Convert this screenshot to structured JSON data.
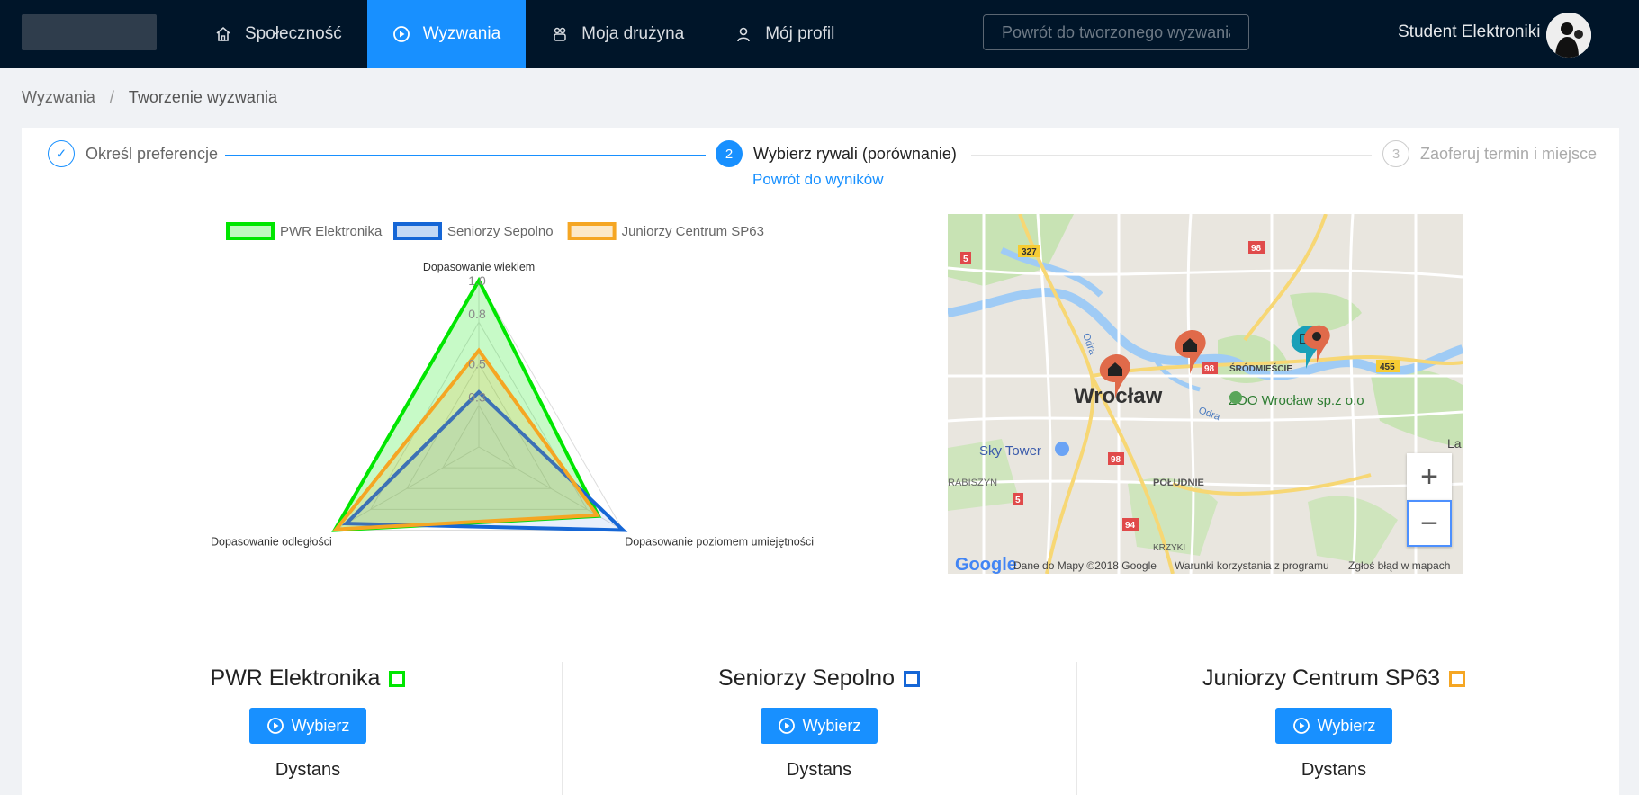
{
  "header": {
    "nav": [
      {
        "label": "Społeczność",
        "icon": "home-icon"
      },
      {
        "label": "Wyzwania",
        "icon": "play-circle-icon"
      },
      {
        "label": "Moja drużyna",
        "icon": "team-icon"
      },
      {
        "label": "Mój profil",
        "icon": "user-icon"
      }
    ],
    "search_placeholder": "Powrót do tworzonego wyzwania",
    "username": "Student Elektroniki"
  },
  "breadcrumb": [
    "Wyzwania",
    "/",
    "Tworzenie wyzwania"
  ],
  "steps": [
    {
      "num": "✓",
      "label": "Określ preferencje",
      "state": "done"
    },
    {
      "num": "2",
      "label": "Wybierz rywali (porównanie)",
      "state": "active"
    },
    {
      "num": "3",
      "label": "Zaoferuj termin i miejsce",
      "state": "pending"
    }
  ],
  "back_link": "Powrót do wyników",
  "chart_data": {
    "type": "radar",
    "axes": [
      "Dopasowanie wiekiem",
      "Dopasowanie poziomem umiejętności",
      "Dopasowanie odległości"
    ],
    "tick_labels": [
      "0.3",
      "0.5",
      "0.8",
      "1.0"
    ],
    "range": [
      0,
      1
    ],
    "legend_position": "top",
    "series": [
      {
        "name": "PWR Elektronika",
        "color": "#00e600",
        "values": [
          1.0,
          0.83,
          1.0
        ]
      },
      {
        "name": "Seniorzy Sepolno",
        "color": "#1566d6",
        "values": [
          0.33,
          1.0,
          0.92
        ]
      },
      {
        "name": "Juniorzy Centrum SP63",
        "color": "#f5a623",
        "values": [
          0.58,
          0.82,
          0.99
        ]
      }
    ]
  },
  "map": {
    "labels": {
      "city": "Wrocław",
      "zoo": "ZOO Wrocław sp.z o.o",
      "sky_tower": "Sky Tower",
      "srodmiescie": "ŚRÓDMIEŚCIE",
      "poludnie": "POŁUDNIE",
      "krzyki": "KRZYKI",
      "grabiszyn": "RABISZYN",
      "river": "Odra",
      "la": "La",
      "road_327": "327",
      "road_98": "98",
      "road_5": "5",
      "road_455": "455",
      "road_94": "94"
    },
    "attribution": [
      "Dane do Mapy ©2018 Google",
      "Warunki korzystania z programu",
      "Zgłoś błąd w mapach"
    ],
    "google": "Google",
    "zoom_in": "+",
    "zoom_out": "−"
  },
  "teams": [
    {
      "name": "PWR Elektronika",
      "color": "#00e600",
      "button": "Wybierz",
      "metric": "Dystans"
    },
    {
      "name": "Seniorzy Sepolno",
      "color": "#1566d6",
      "button": "Wybierz",
      "metric": "Dystans"
    },
    {
      "name": "Juniorzy Centrum SP63",
      "color": "#f5a623",
      "button": "Wybierz",
      "metric": "Dystans"
    }
  ]
}
